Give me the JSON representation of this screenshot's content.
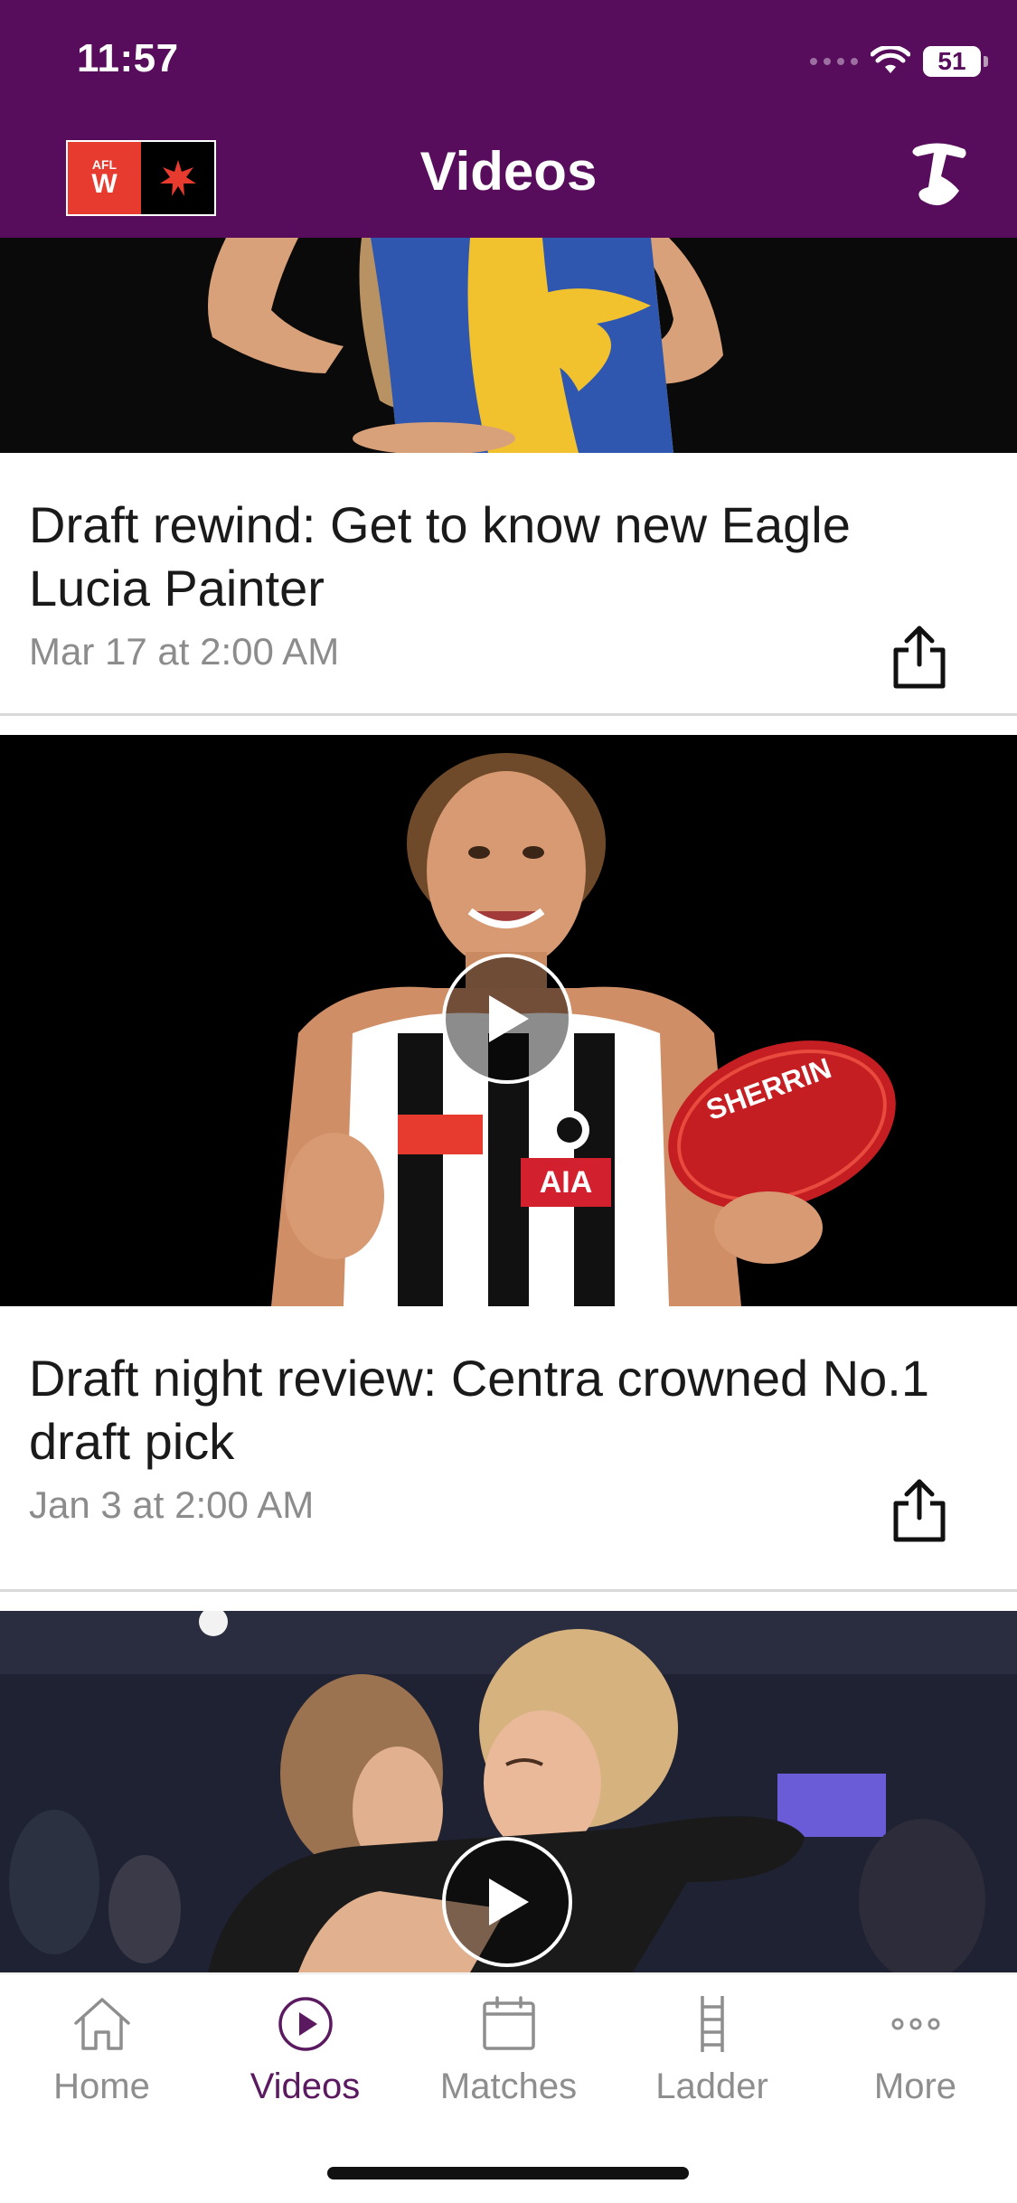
{
  "status_bar": {
    "time": "11:57",
    "battery": "51"
  },
  "header": {
    "title": "Videos",
    "logo_text": "AFL"
  },
  "videos": [
    {
      "title": "Draft rewind: Get to know new Eagle Lucia Painter",
      "date": "Mar 17 at 2:00 AM",
      "thumbnail": "player-in-eagles-jersey"
    },
    {
      "title": "Draft night review: Centra crowned No.1 draft pick",
      "date": "Jan 3 at 2:00 AM",
      "thumbnail": "player-in-magpies-jersey-with-football",
      "jersey_sponsor": "AIA",
      "ball_brand": "SHERRIN"
    },
    {
      "title": "",
      "date": "",
      "thumbnail": "players-hugging"
    }
  ],
  "tabs": [
    {
      "label": "Home",
      "icon": "home-icon",
      "active": false
    },
    {
      "label": "Videos",
      "icon": "play-circle-icon",
      "active": true
    },
    {
      "label": "Matches",
      "icon": "calendar-icon",
      "active": false
    },
    {
      "label": "Ladder",
      "icon": "ladder-icon",
      "active": false
    },
    {
      "label": "More",
      "icon": "more-dots-icon",
      "active": false
    }
  ],
  "colors": {
    "header_bg": "#570d5b",
    "active_tab": "#5b1960",
    "inactive_tab": "#8e8e8e"
  }
}
